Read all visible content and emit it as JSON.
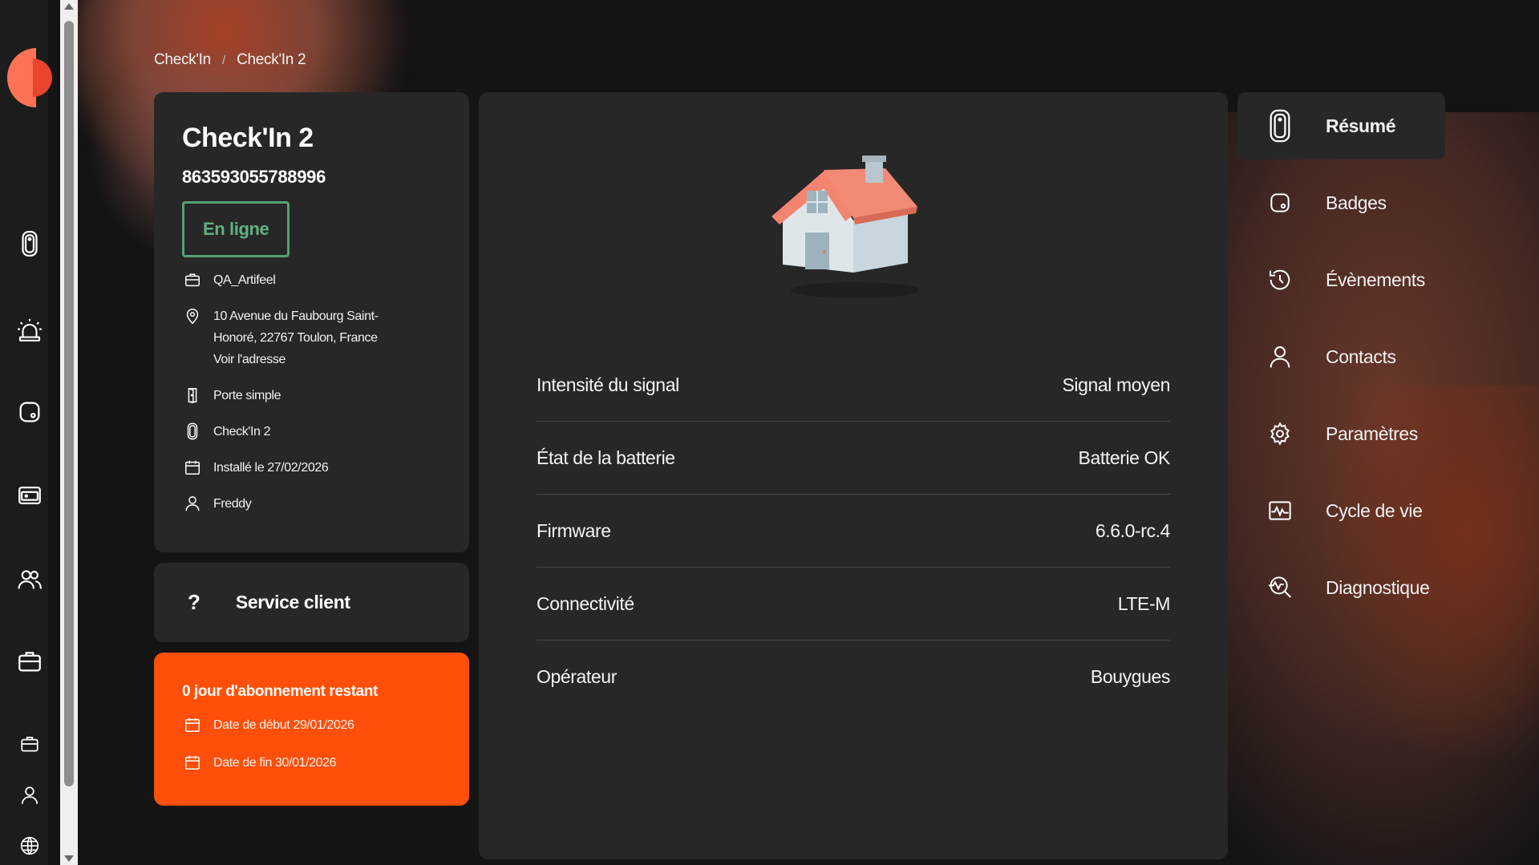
{
  "breadcrumb": {
    "root": "Check'In",
    "separator": "/",
    "current": "Check'In 2"
  },
  "device": {
    "title": "Check'In 2",
    "serial": "863593055788996",
    "status": "En ligne",
    "organization": "QA_Artifeel",
    "address_line1": "10 Avenue du Faubourg Saint-",
    "address_line2": "Honoré, 22767 Toulon, France",
    "address_link": "Voir l'adresse",
    "door_type": "Porte simple",
    "model": "Check'In 2",
    "installed": "Installé le 27/02/2026",
    "user": "Freddy"
  },
  "support": {
    "icon": "?",
    "label": "Service client"
  },
  "subscription": {
    "title": "0 jour d'abonnement restant",
    "start": "Date de début 29/01/2026",
    "end": "Date de fin 30/01/2026"
  },
  "details": [
    {
      "label": "Intensité du signal",
      "value": "Signal moyen"
    },
    {
      "label": "État de la batterie",
      "value": "Batterie OK"
    },
    {
      "label": "Firmware",
      "value": "6.6.0-rc.4"
    },
    {
      "label": "Connectivité",
      "value": "LTE-M"
    },
    {
      "label": "Opérateur",
      "value": "Bouygues"
    }
  ],
  "side_nav": [
    {
      "label": "Résumé",
      "icon": "device-icon",
      "active": true
    },
    {
      "label": "Badges",
      "icon": "badge-icon"
    },
    {
      "label": "Évènements",
      "icon": "history-icon"
    },
    {
      "label": "Contacts",
      "icon": "person-icon"
    },
    {
      "label": "Paramètres",
      "icon": "gear-icon"
    },
    {
      "label": "Cycle de vie",
      "icon": "activity-icon"
    },
    {
      "label": "Diagnostique",
      "icon": "diagnostic-icon"
    }
  ],
  "rail_icons": [
    "logo-icon",
    "device-icon",
    "alarm-icon",
    "badge-icon",
    "wallet-icon",
    "users-icon",
    "briefcase-icon",
    "briefcase-small-icon",
    "person-icon",
    "globe-icon"
  ],
  "colors": {
    "accent": "#ff4f0a",
    "online": "#54a176",
    "card": "#272727",
    "background": "#141414"
  }
}
